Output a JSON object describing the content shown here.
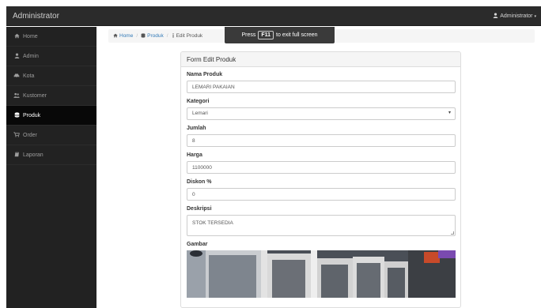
{
  "navbar": {
    "brand": "Administrator",
    "user": "Administrator"
  },
  "sidebar": {
    "items": [
      {
        "label": "Home",
        "icon": "home-icon",
        "active": false
      },
      {
        "label": "Admin",
        "icon": "user-icon",
        "active": false
      },
      {
        "label": "Kota",
        "icon": "car-icon",
        "active": false
      },
      {
        "label": "Kustomer",
        "icon": "users-icon",
        "active": false
      },
      {
        "label": "Produk",
        "icon": "database-icon",
        "active": true
      },
      {
        "label": "Order",
        "icon": "cart-icon",
        "active": false
      },
      {
        "label": "Laporan",
        "icon": "book-icon",
        "active": false
      }
    ]
  },
  "breadcrumb": {
    "home": "Home",
    "produk": "Produk",
    "current": "Edit Produk"
  },
  "toast": {
    "prefix": "Press",
    "key": "F11",
    "suffix": "to exit full screen"
  },
  "form": {
    "title": "Form Edit Produk",
    "nama_label": "Nama Produk",
    "nama_value": "LEMARI PAKAIAN",
    "kategori_label": "Kategori",
    "kategori_value": "Lemari",
    "jumlah_label": "Jumlah",
    "jumlah_value": "8",
    "harga_label": "Harga",
    "harga_value": "1100000",
    "diskon_label": "Diskon %",
    "diskon_value": "0",
    "deskripsi_label": "Deskripsi",
    "deskripsi_value": "STOK TERSEDIA",
    "gambar_label": "Gambar"
  }
}
